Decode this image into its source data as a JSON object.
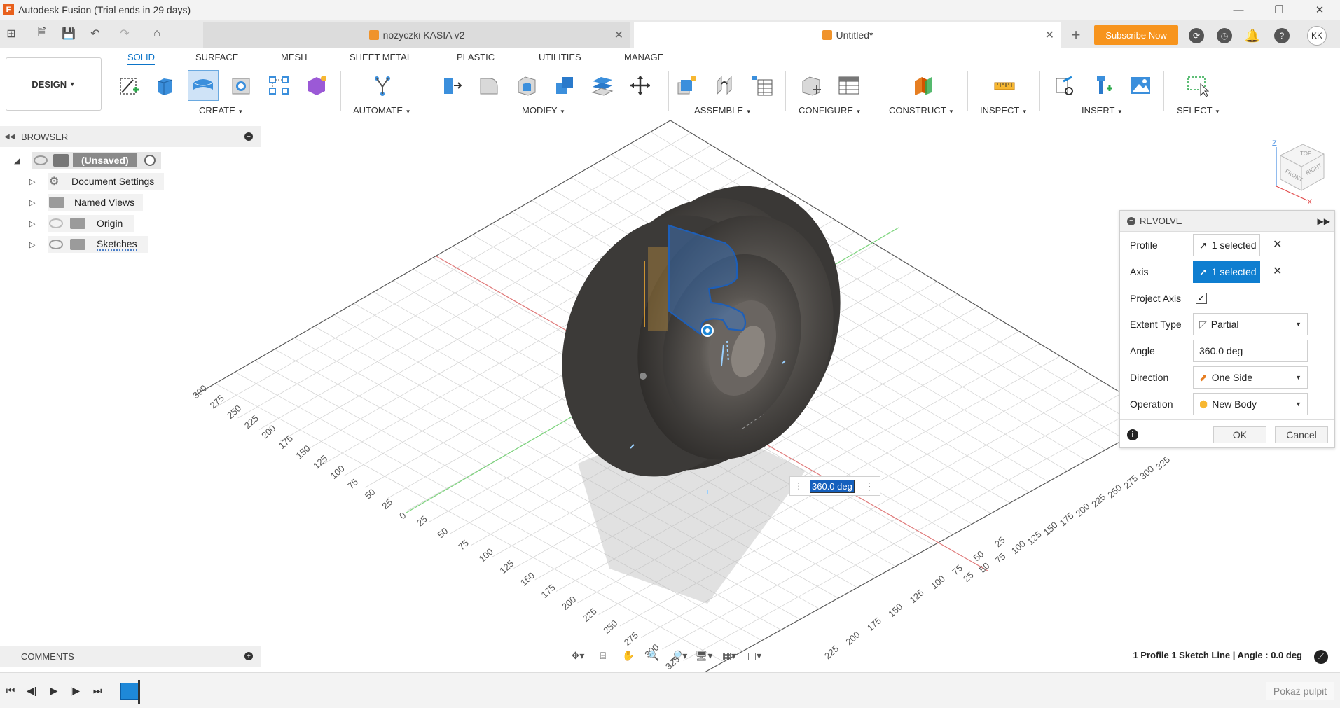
{
  "window": {
    "title": "Autodesk Fusion (Trial ends in 29 days)",
    "app_icon_letter": "F"
  },
  "tabs": [
    {
      "label": "nożyczki KASIA v2"
    },
    {
      "label": "Untitled*"
    }
  ],
  "subscribe_label": "Subscribe Now",
  "avatar_initials": "KK",
  "toolbar": {
    "design_label": "DESIGN",
    "workspace_tabs": [
      "SOLID",
      "SURFACE",
      "MESH",
      "SHEET METAL",
      "PLASTIC",
      "UTILITIES",
      "MANAGE"
    ],
    "groups": [
      "CREATE",
      "AUTOMATE",
      "MODIFY",
      "ASSEMBLE",
      "CONFIGURE",
      "CONSTRUCT",
      "INSPECT",
      "INSERT",
      "SELECT"
    ]
  },
  "browser": {
    "title": "BROWSER",
    "items": [
      {
        "label": "(Unsaved)"
      },
      {
        "label": "Document Settings"
      },
      {
        "label": "Named Views"
      },
      {
        "label": "Origin"
      },
      {
        "label": "Sketches"
      }
    ]
  },
  "viewcube": {
    "top": "TOP",
    "front": "FRONT",
    "right": "RIGHT",
    "axis_z": "Z",
    "axis_x": "X"
  },
  "revolve": {
    "title": "REVOLVE",
    "profile_label": "Profile",
    "profile_value": "1 selected",
    "axis_label": "Axis",
    "axis_value": "1 selected",
    "project_axis_label": "Project Axis",
    "project_axis_checked": true,
    "extent_type_label": "Extent Type",
    "extent_type_value": "Partial",
    "angle_label": "Angle",
    "angle_value": "360.0 deg",
    "direction_label": "Direction",
    "direction_value": "One Side",
    "operation_label": "Operation",
    "operation_value": "New Body",
    "ok_label": "OK",
    "cancel_label": "Cancel"
  },
  "angle_input_value": "360.0 deg",
  "ruler_left": [
    "300",
    "275",
    "250",
    "225",
    "200",
    "175",
    "150",
    "125",
    "100",
    "75",
    "50",
    "25",
    "0"
  ],
  "ruler_bottom": [
    "25",
    "50",
    "75",
    "100",
    "125",
    "150",
    "175",
    "200",
    "225",
    "250",
    "275",
    "300",
    "325"
  ],
  "ruler_right_top": [
    "325",
    "300",
    "275",
    "250",
    "225",
    "200",
    "175",
    "150",
    "125",
    "100",
    "75",
    "50",
    "25"
  ],
  "ruler_right_bottom": [
    "25",
    "50",
    "75",
    "100",
    "125",
    "150",
    "175",
    "200",
    "225"
  ],
  "comments_label": "COMMENTS",
  "status_text": "1 Profile 1 Sketch Line | Angle : 0.0 deg",
  "pokaz_label": "Pokaż pulpit",
  "colors": {
    "accent": "#0b74c8",
    "subscribe": "#f7941d",
    "selection": "#0f7ed0"
  }
}
